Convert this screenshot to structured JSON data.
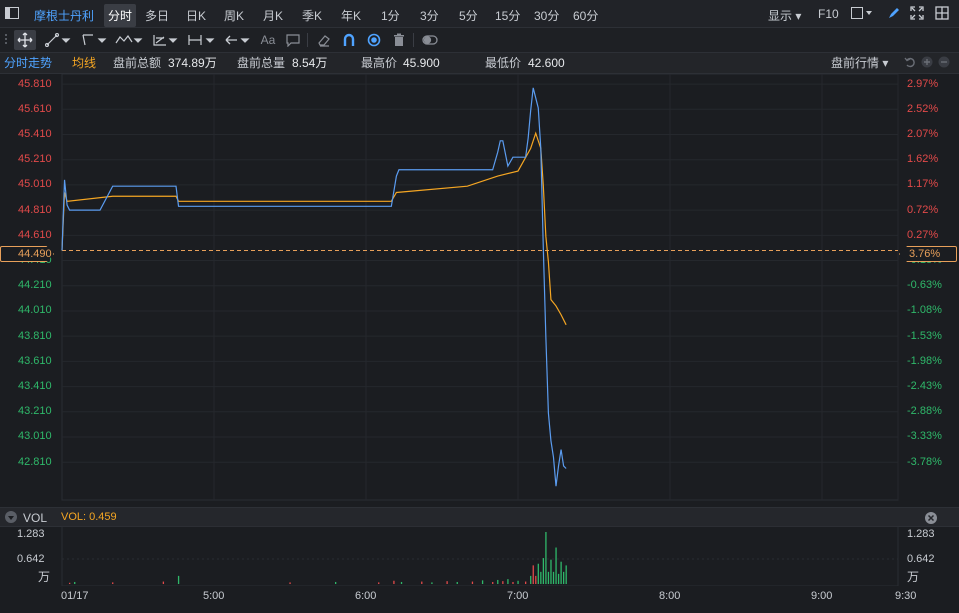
{
  "header": {
    "stock_name": "摩根士丹利",
    "tabs": [
      "分时",
      "多日",
      "日K",
      "周K",
      "月K",
      "季K",
      "年K",
      "1分",
      "3分",
      "5分",
      "15分",
      "30分",
      "60分"
    ],
    "active_tab": "分时",
    "display_label": "显示",
    "f10_label": "F10"
  },
  "info": {
    "mode": "分时走势",
    "avg_label": "均线",
    "amount_label": "盘前总额",
    "amount_value": "374.89万",
    "volume_label": "盘前总量",
    "volume_value": "8.54万",
    "high_label": "最高价",
    "high_value": "45.900",
    "low_label": "最低价",
    "low_value": "42.600",
    "session_label": "盘前行情"
  },
  "chart": {
    "ref_price_label": "44.490",
    "ref_pct_label": "3.76%",
    "price_ticks": [
      "45.810",
      "45.610",
      "45.410",
      "45.210",
      "45.010",
      "44.810",
      "44.610",
      "44.410",
      "44.210",
      "44.010",
      "43.810",
      "43.610",
      "43.410",
      "43.210",
      "43.010",
      "42.810"
    ],
    "pct_ticks": [
      "2.97%",
      "2.52%",
      "2.07%",
      "1.62%",
      "1.17%",
      "0.72%",
      "0.27%",
      "-0.18%",
      "-0.63%",
      "-1.08%",
      "-1.53%",
      "-1.98%",
      "-2.43%",
      "-2.88%",
      "-3.33%",
      "-3.78%"
    ],
    "colors": {
      "price_line": "#5b9cf0",
      "avg_line": "#f5a623",
      "up": "#e24a4a",
      "down": "#2fb86a",
      "ref": "#e8a05a"
    }
  },
  "volume": {
    "title": "VOL",
    "value_label": "VOL: 0.459",
    "max_label": "1.283",
    "mid_label": "0.642",
    "unit_label": "万"
  },
  "x_axis": [
    "01/17",
    "5:00",
    "6:00",
    "7:00",
    "8:00",
    "9:00",
    "9:30"
  ],
  "chart_data": {
    "type": "line",
    "x_range": [
      "04:00",
      "09:30"
    ],
    "y_range": [
      42.51,
      45.89
    ],
    "series": [
      {
        "name": "分时",
        "points": [
          [
            "04:00",
            44.49
          ],
          [
            "04:01",
            45.05
          ],
          [
            "04:02",
            44.85
          ],
          [
            "04:03",
            44.81
          ],
          [
            "04:15",
            44.81
          ],
          [
            "04:20",
            45.0
          ],
          [
            "04:45",
            45.0
          ],
          [
            "04:46",
            44.84
          ],
          [
            "05:10",
            44.84
          ],
          [
            "05:40",
            44.84
          ],
          [
            "06:10",
            44.84
          ],
          [
            "06:12",
            45.08
          ],
          [
            "06:13",
            45.13
          ],
          [
            "06:35",
            45.13
          ],
          [
            "06:50",
            45.13
          ],
          [
            "06:52",
            45.27
          ],
          [
            "06:53",
            45.36
          ],
          [
            "06:54",
            45.36
          ],
          [
            "06:56",
            45.16
          ],
          [
            "06:58",
            45.23
          ],
          [
            "07:03",
            45.23
          ],
          [
            "07:04",
            45.38
          ],
          [
            "07:05",
            45.6
          ],
          [
            "07:06",
            45.78
          ],
          [
            "07:07",
            45.7
          ],
          [
            "07:08",
            45.62
          ],
          [
            "07:09",
            45.3
          ],
          [
            "07:10",
            44.5
          ],
          [
            "07:11",
            43.8
          ],
          [
            "07:12",
            43.2
          ],
          [
            "07:13",
            42.98
          ],
          [
            "07:14",
            42.85
          ],
          [
            "07:15",
            42.62
          ],
          [
            "07:16",
            42.78
          ],
          [
            "07:17",
            42.91
          ],
          [
            "07:18",
            42.78
          ],
          [
            "07:19",
            42.76
          ]
        ]
      },
      {
        "name": "均线",
        "points": [
          [
            "04:00",
            44.49
          ],
          [
            "04:01",
            44.95
          ],
          [
            "04:02",
            44.88
          ],
          [
            "04:20",
            44.92
          ],
          [
            "04:45",
            44.92
          ],
          [
            "04:46",
            44.88
          ],
          [
            "06:10",
            44.88
          ],
          [
            "06:12",
            44.95
          ],
          [
            "06:40",
            45.0
          ],
          [
            "06:52",
            45.08
          ],
          [
            "07:00",
            45.12
          ],
          [
            "07:05",
            45.3
          ],
          [
            "07:07",
            45.42
          ],
          [
            "07:09",
            45.3
          ],
          [
            "07:10",
            45.0
          ],
          [
            "07:11",
            44.6
          ],
          [
            "07:12",
            44.4
          ],
          [
            "07:13",
            44.1
          ],
          [
            "07:15",
            44.05
          ],
          [
            "07:17",
            43.98
          ],
          [
            "07:19",
            43.9
          ]
        ]
      }
    ],
    "volume_series": [
      {
        "t": "04:03",
        "v": 0.03,
        "up": true
      },
      {
        "t": "04:05",
        "v": 0.05,
        "up": false
      },
      {
        "t": "04:20",
        "v": 0.04,
        "up": true
      },
      {
        "t": "04:40",
        "v": 0.06,
        "up": true
      },
      {
        "t": "04:46",
        "v": 0.2,
        "up": false
      },
      {
        "t": "05:30",
        "v": 0.04,
        "up": true
      },
      {
        "t": "05:48",
        "v": 0.05,
        "up": false
      },
      {
        "t": "06:05",
        "v": 0.04,
        "up": true
      },
      {
        "t": "06:11",
        "v": 0.08,
        "up": true
      },
      {
        "t": "06:14",
        "v": 0.05,
        "up": false
      },
      {
        "t": "06:22",
        "v": 0.06,
        "up": true
      },
      {
        "t": "06:26",
        "v": 0.04,
        "up": false
      },
      {
        "t": "06:32",
        "v": 0.07,
        "up": true
      },
      {
        "t": "06:36",
        "v": 0.05,
        "up": false
      },
      {
        "t": "06:42",
        "v": 0.06,
        "up": true
      },
      {
        "t": "06:46",
        "v": 0.09,
        "up": false
      },
      {
        "t": "06:50",
        "v": 0.05,
        "up": true
      },
      {
        "t": "06:52",
        "v": 0.1,
        "up": false
      },
      {
        "t": "06:54",
        "v": 0.07,
        "up": true
      },
      {
        "t": "06:56",
        "v": 0.12,
        "up": false
      },
      {
        "t": "06:58",
        "v": 0.05,
        "up": true
      },
      {
        "t": "07:00",
        "v": 0.08,
        "up": false
      },
      {
        "t": "07:03",
        "v": 0.06,
        "up": true
      },
      {
        "t": "07:05",
        "v": 0.2,
        "up": false
      },
      {
        "t": "07:06",
        "v": 0.46,
        "up": true
      },
      {
        "t": "07:07",
        "v": 0.2,
        "up": true
      },
      {
        "t": "07:08",
        "v": 0.5,
        "up": false
      },
      {
        "t": "07:09",
        "v": 0.3,
        "up": false
      },
      {
        "t": "07:10",
        "v": 0.64,
        "up": false
      },
      {
        "t": "07:11",
        "v": 1.283,
        "up": false
      },
      {
        "t": "07:12",
        "v": 0.3,
        "up": false
      },
      {
        "t": "07:13",
        "v": 0.6,
        "up": false
      },
      {
        "t": "07:14",
        "v": 0.3,
        "up": false
      },
      {
        "t": "07:15",
        "v": 0.9,
        "up": false
      },
      {
        "t": "07:16",
        "v": 0.25,
        "up": false
      },
      {
        "t": "07:17",
        "v": 0.55,
        "up": false
      },
      {
        "t": "07:18",
        "v": 0.3,
        "up": false
      },
      {
        "t": "07:19",
        "v": 0.459,
        "up": false
      }
    ]
  }
}
